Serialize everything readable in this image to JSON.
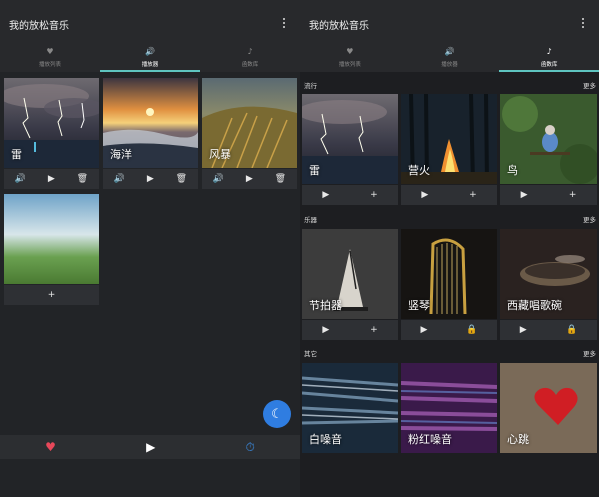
{
  "left": {
    "title": "我的放松音乐",
    "tabs": [
      {
        "icon": "♥",
        "label": "播放列表"
      },
      {
        "icon": "🔊",
        "label": "播放器"
      },
      {
        "icon": "♪",
        "label": "函数库"
      }
    ],
    "players": [
      {
        "name": "雷",
        "volume_icon": "🔊",
        "play_icon": "▶",
        "delete_icon": "🗑"
      },
      {
        "name": "海洋",
        "volume_icon": "🔊",
        "play_icon": "▶",
        "delete_icon": "🗑"
      },
      {
        "name": "风暴",
        "volume_icon": "🔊",
        "play_icon": "▶",
        "delete_icon": "🗑"
      }
    ],
    "add_icon": "+",
    "bottom": {
      "heart": "♥",
      "play": "▶",
      "timer": "⏱"
    },
    "fab_icon": "☾"
  },
  "right": {
    "title": "我的放松音乐",
    "tabs": [
      {
        "icon": "♥",
        "label": "播放列表"
      },
      {
        "icon": "🔊",
        "label": "播放器"
      },
      {
        "icon": "♪",
        "label": "函数库"
      }
    ],
    "sections": [
      {
        "title": "流行",
        "more": "更多",
        "items": [
          {
            "name": "雷",
            "play": "▶",
            "action": "+"
          },
          {
            "name": "营火",
            "play": "▶",
            "action": "+"
          },
          {
            "name": "鸟",
            "play": "▶",
            "action": "+"
          }
        ]
      },
      {
        "title": "乐器",
        "more": "更多",
        "items": [
          {
            "name": "节拍器",
            "play": "▶",
            "action": "+"
          },
          {
            "name": "竖琴",
            "play": "▶",
            "action": "🔒"
          },
          {
            "name": "西藏唱歌碗",
            "play": "▶",
            "action": "🔒"
          }
        ]
      },
      {
        "title": "其它",
        "more": "更多",
        "items": [
          {
            "name": "白噪音"
          },
          {
            "name": "粉红噪音"
          },
          {
            "name": "心跳"
          }
        ]
      }
    ]
  },
  "colors": {
    "accent": "#5ec4c0",
    "fab": "#2f7de1",
    "heart": "#e8485a",
    "timer": "#3b8fe8"
  }
}
